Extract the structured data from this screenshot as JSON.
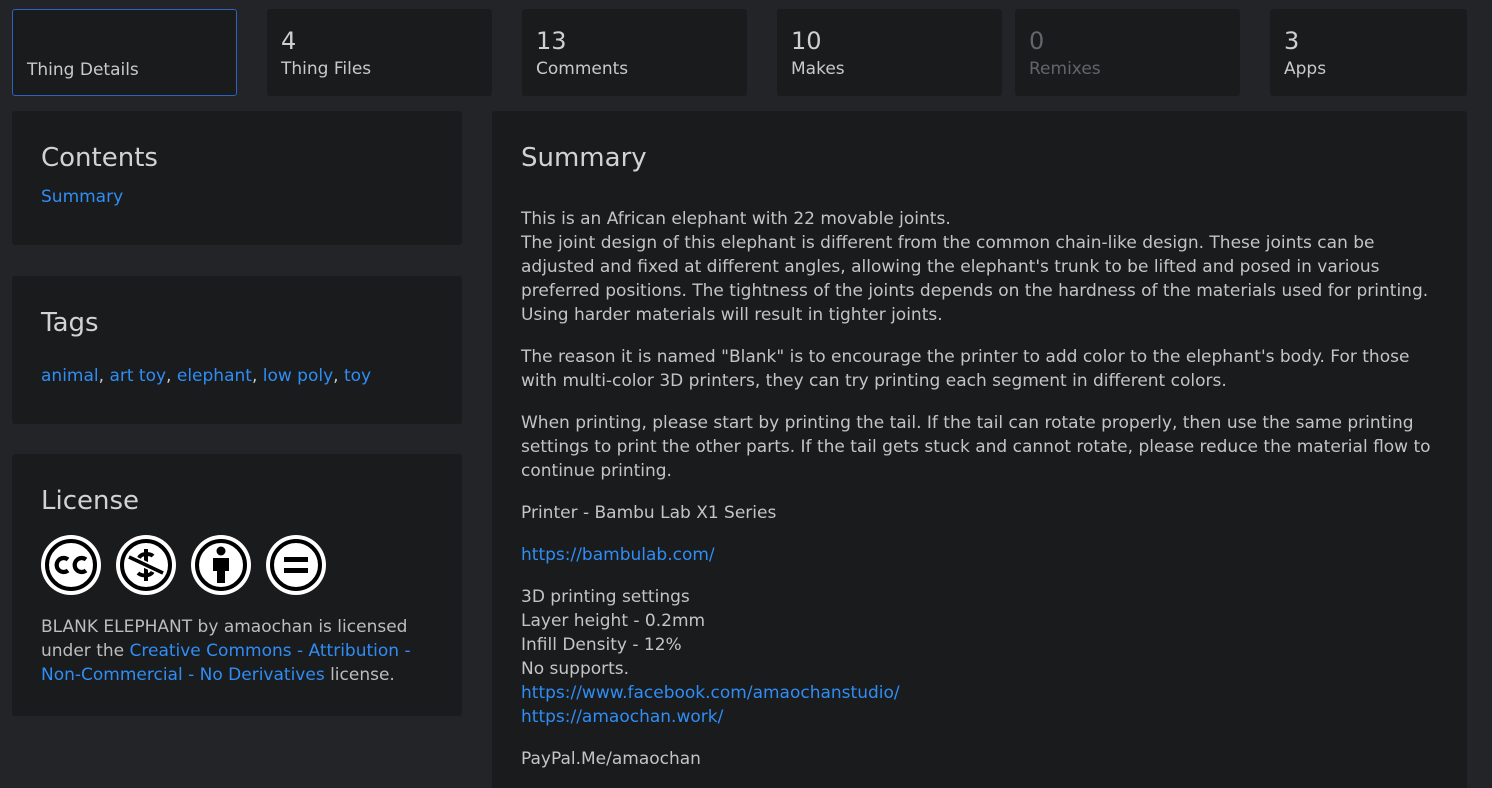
{
  "tabs": [
    {
      "count": "",
      "label": "Thing Details"
    },
    {
      "count": "4",
      "label": "Thing Files"
    },
    {
      "count": "13",
      "label": "Comments"
    },
    {
      "count": "10",
      "label": "Makes"
    },
    {
      "count": "0",
      "label": "Remixes"
    },
    {
      "count": "3",
      "label": "Apps"
    }
  ],
  "contents": {
    "title": "Contents",
    "link": "Summary"
  },
  "tags": {
    "title": "Tags",
    "items": [
      "animal",
      "art toy",
      "elephant",
      "low poly",
      "toy"
    ],
    "sep": ", "
  },
  "license": {
    "title": "License",
    "icons": [
      "cc-icon",
      "non-commercial-icon",
      "attribution-icon",
      "no-derivatives-icon"
    ],
    "thing_name": "BLANK ELEPHANT",
    "by": "by",
    "author": "amaochan",
    "licensed": "is licensed",
    "under": "under the",
    "license_name": "Creative Commons - Attribution - Non-Commercial - No Derivatives",
    "suffix": "license."
  },
  "summary": {
    "title": "Summary",
    "p1_line1": "This is an African elephant with 22 movable joints.",
    "p1_line2": "The joint design of this elephant is different from the common chain-like design. These joints can be adjusted and fixed at different angles, allowing the elephant's trunk to be lifted and posed in various preferred positions. The tightness of the joints depends on the hardness of the materials used for printing. Using harder materials will result in tighter joints.",
    "p2": "The reason it is named \"Blank\" is to encourage the printer to add color to the elephant's body. For those with multi-color 3D printers, they can try printing each segment in different colors.",
    "p3": "When printing, please start by printing the tail. If the tail can rotate properly, then use the same printing settings to print the other parts. If the tail gets stuck and cannot rotate, please reduce the material flow to continue printing.",
    "printer": "Printer - Bambu Lab X1 Series",
    "printer_link": "https://bambulab.com/",
    "settings_title": "3D printing settings",
    "layer_height": "Layer height - 0.2mm",
    "infill": "Infill Density - 12%",
    "supports": "No supports.",
    "facebook_link": "https://www.facebook.com/amaochanstudio/",
    "site_link": "https://amaochan.work/",
    "paypal": "PayPal.Me/amaochan"
  },
  "colors": {
    "background": "#222427",
    "card": "#1a1b1d",
    "link": "#2f8df5",
    "active_tab_border": "#2c63bc"
  }
}
